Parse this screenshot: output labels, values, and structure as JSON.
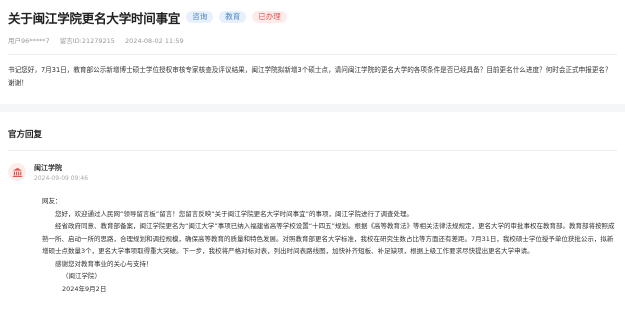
{
  "question": {
    "title": "关于闽江学院更名大学时间事宜",
    "tags": [
      "咨询",
      "教育",
      "已办理"
    ],
    "user": "用户96*****7",
    "message_id": "留言ID:21279215",
    "date": "2024-08-02 11:59",
    "content": "书记您好，7月31日，教育部公示新增博士硕士学位授权审核专家核查及评议结果，闽江学院拟新增3个硕士点，请问闽江学院的更名大学的各项条件是否已经具备？目前更名什么进度？何时会正式申报更名？谢谢！"
  },
  "reply": {
    "section_title": "官方回复",
    "org_name": "闽江学院",
    "org_date": "2024-09-09 09:46",
    "greeting": "网友：",
    "paragraphs": [
      "您好，欢迎通过人民网“领导留言板”留言！您留言反映“关于闽江学院更名大学时间事宜”的事项，闽江学院进行了调查处理。",
      "经省政府同意、教育部备案，闽江学院更名为“闽江大学”事项已纳入福建省高等学校设置“十四五”规划。根据《高等教育法》等相关法律法规规定，更名大学的审批事权在教育部。教育部将按照成熟一所、启动一所的思路，合理规划和调控规模，确保高等教育的质量和特色发展。对照教育部更名大学标准，我校在研究生数占比等方面还有差距。7月31日，我校硕士学位授予单位获批公示，拟新增硕士点数量3个，更名大学事项取得重大突破。下一步，我校将严格对标对表，列出时间表路线图，加快补齐短板、补足缺项，根据上级工作要求尽快提出更名大学申请。",
      "感谢您对教育事业的关心与支持！"
    ],
    "signature": "（闽江学院）",
    "sign_date": "2024年9月2日"
  }
}
